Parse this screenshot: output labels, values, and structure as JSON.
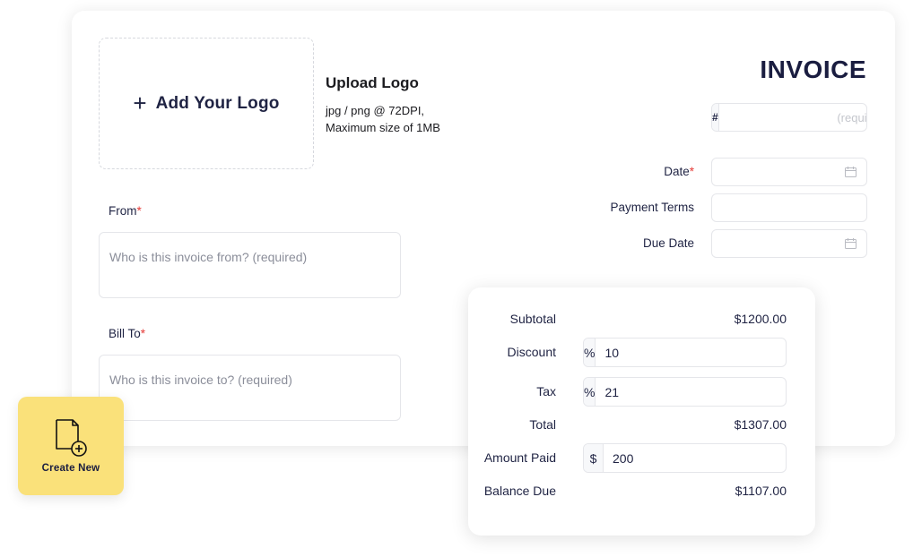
{
  "logo_upload": {
    "button_label": "Add Your Logo",
    "plus_icon": "plus-icon",
    "title": "Upload Logo",
    "desc_line1": "jpg / png @ 72DPI,",
    "desc_line2": "Maximum size of 1MB"
  },
  "invoice": {
    "title": "INVOICE",
    "number_prefix": "#",
    "number_value": "",
    "number_placeholder": "(required)"
  },
  "meta_fields": {
    "date_label": "Date",
    "date_value": "",
    "payment_terms_label": "Payment Terms",
    "payment_terms_value": "",
    "due_date_label": "Due Date",
    "due_date_value": "",
    "required_mark": "*",
    "calendar_icon": "calendar-icon"
  },
  "parties": {
    "from_label": "From",
    "from_value": "",
    "from_placeholder": "Who is this invoice from? (required)",
    "bill_to_label": "Bill To",
    "bill_to_value": "",
    "bill_to_placeholder": "Who is this invoice to? (required)"
  },
  "create_new": {
    "label": "Create New",
    "icon": "new-document-icon"
  },
  "totals": {
    "subtotal_label": "Subtotal",
    "subtotal_value": "$1200.00",
    "discount_label": "Discount",
    "discount_unit": "%",
    "discount_value": "10",
    "tax_label": "Tax",
    "tax_unit": "%",
    "tax_value": "21",
    "total_label": "Total",
    "total_value": "$1307.00",
    "amount_paid_label": "Amount Paid",
    "amount_paid_unit": "$",
    "amount_paid_value": "200",
    "balance_due_label": "Balance Due",
    "balance_due_value": "$1107.00",
    "toggle_icon": "swap-unit-icon"
  },
  "colors": {
    "accent_yellow": "#fae17a",
    "heading_navy": "#1a1d40",
    "required_red": "#e53935"
  }
}
